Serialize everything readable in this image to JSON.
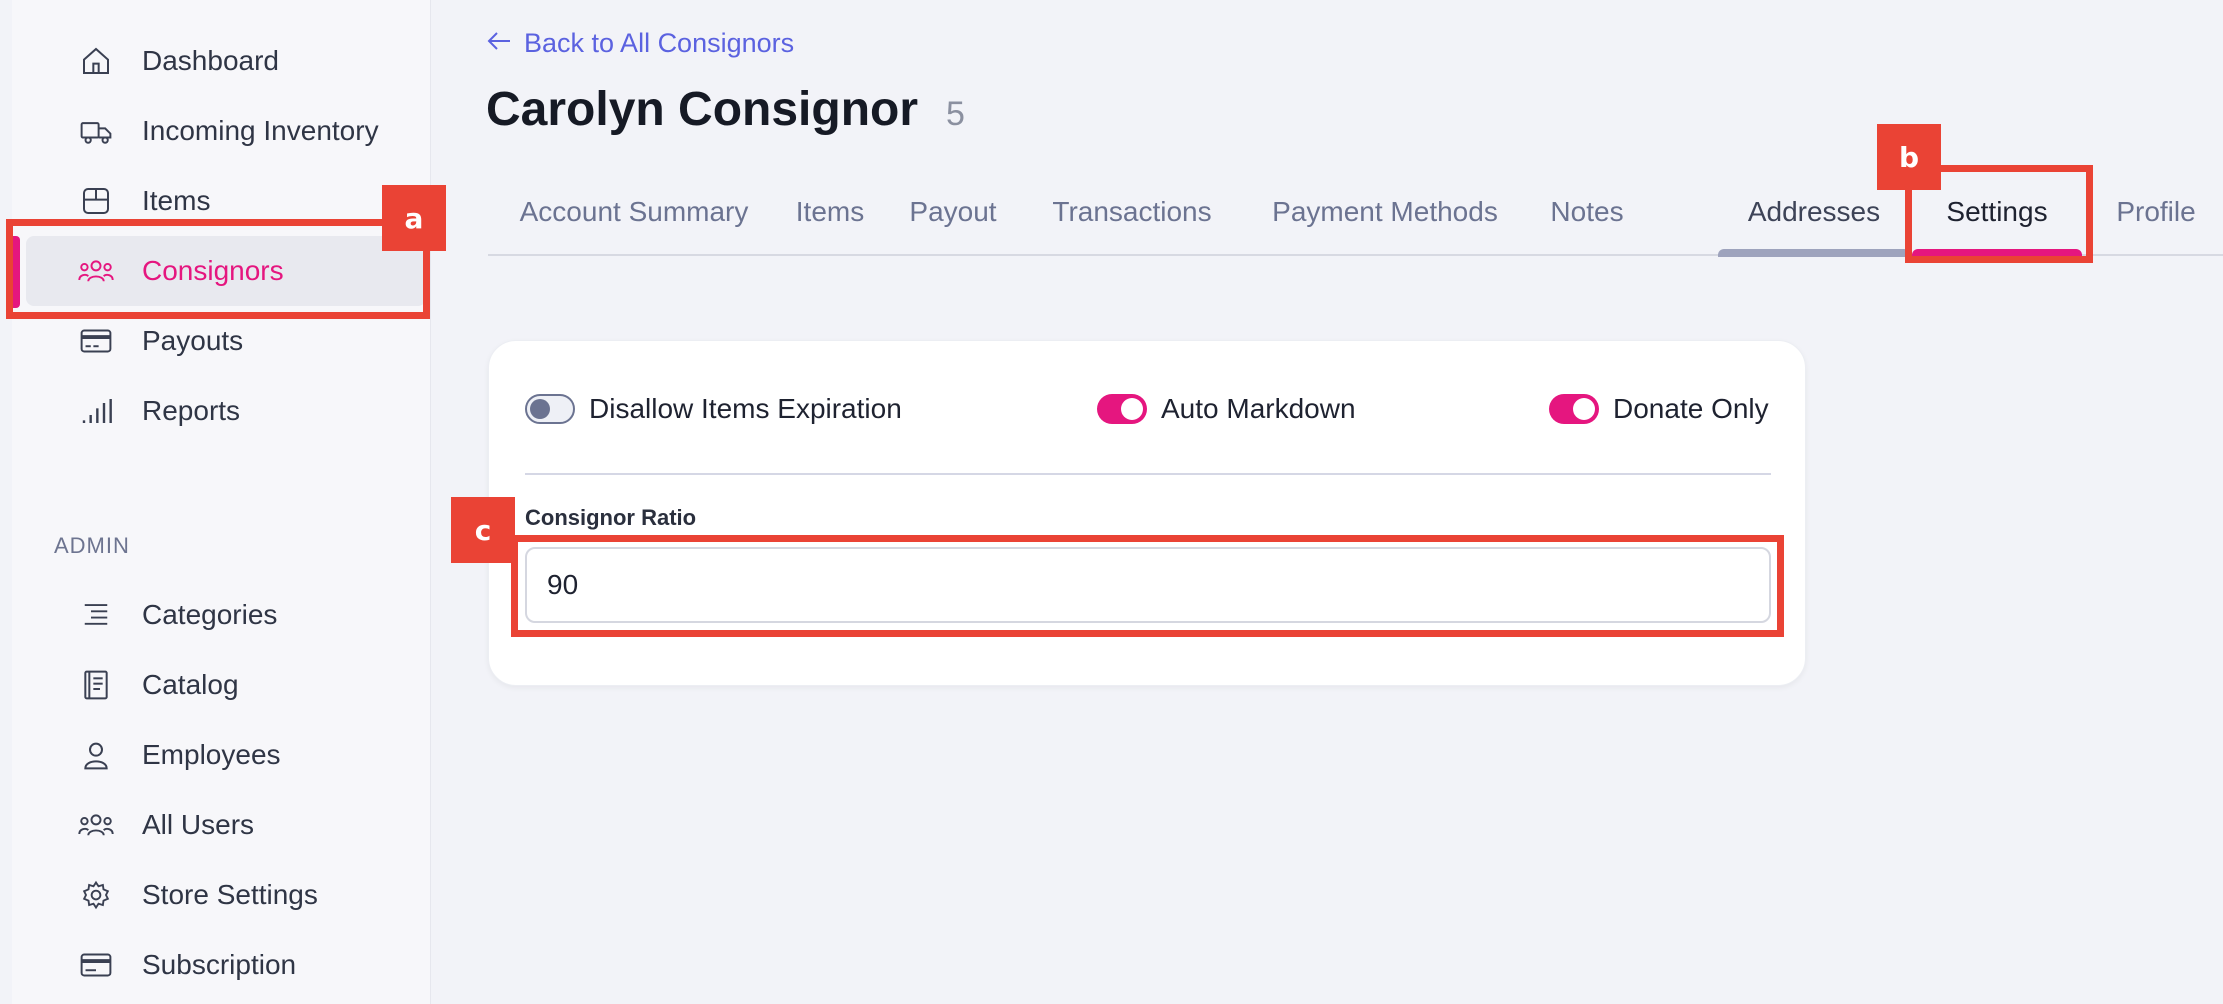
{
  "sidebar": {
    "items": [
      {
        "label": "Dashboard",
        "icon": "home-icon"
      },
      {
        "label": "Incoming Inventory",
        "icon": "truck-icon"
      },
      {
        "label": "Items",
        "icon": "box-icon"
      },
      {
        "label": "Consignors",
        "icon": "users-icon",
        "active": true
      },
      {
        "label": "Payouts",
        "icon": "credit-card-icon"
      },
      {
        "label": "Reports",
        "icon": "bar-chart-icon"
      }
    ],
    "admin_heading": "ADMIN",
    "admin_items": [
      {
        "label": "Categories",
        "icon": "list-indent-icon"
      },
      {
        "label": "Catalog",
        "icon": "book-icon"
      },
      {
        "label": "Employees",
        "icon": "user-icon"
      },
      {
        "label": "All Users",
        "icon": "users-icon"
      },
      {
        "label": "Store Settings",
        "icon": "gear-icon"
      },
      {
        "label": "Subscription",
        "icon": "credit-card-icon"
      }
    ]
  },
  "header": {
    "back_label": "Back to All Consignors",
    "title": "Carolyn Consignor",
    "count": "5"
  },
  "tabs": [
    {
      "label": "Account Summary"
    },
    {
      "label": "Items"
    },
    {
      "label": "Payout"
    },
    {
      "label": "Transactions"
    },
    {
      "label": "Payment Methods"
    },
    {
      "label": "Notes"
    },
    {
      "label": "Addresses",
      "state": "hover"
    },
    {
      "label": "Settings",
      "state": "active"
    },
    {
      "label": "Profile"
    }
  ],
  "settings": {
    "toggles": [
      {
        "label": "Disallow Items Expiration",
        "on": false
      },
      {
        "label": "Auto Markdown",
        "on": true
      },
      {
        "label": "Donate Only",
        "on": true
      }
    ],
    "ratio_label": "Consignor Ratio",
    "ratio_value": "90"
  },
  "annotations": {
    "a": "a",
    "b": "b",
    "c": "c"
  },
  "colors": {
    "accent": "#e5167f",
    "link": "#5b62e0",
    "annotation": "#ea4335"
  }
}
